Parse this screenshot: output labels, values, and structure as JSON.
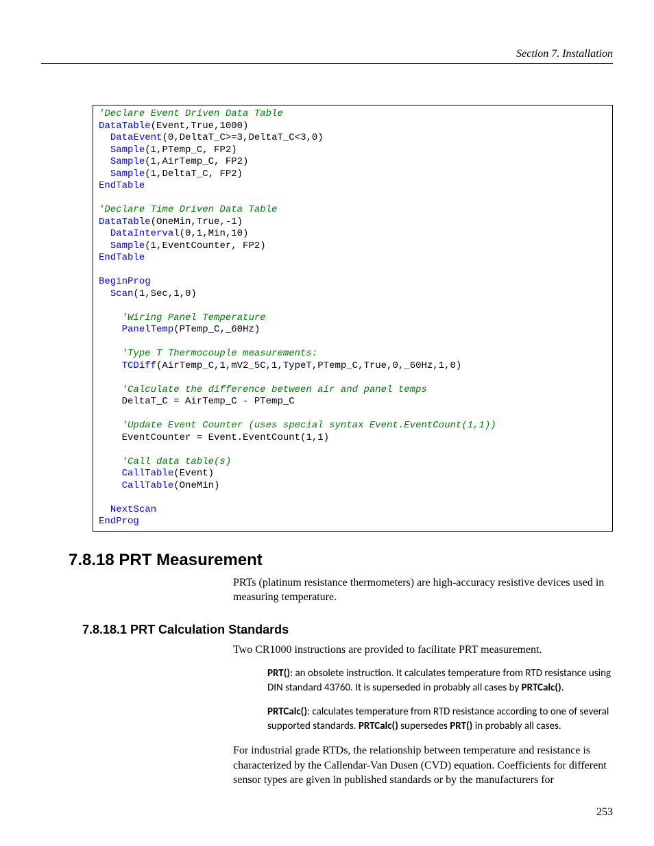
{
  "header": "Section 7.  Installation",
  "code": {
    "c1": "'Declare Event Driven Data Table",
    "l2a": "DataTable",
    "l2b": "(Event,True,1000)",
    "l3a": "DataEvent",
    "l3b": "(0,DeltaT_C>=3,DeltaT_C<3,0)",
    "l4a": "Sample",
    "l4b": "(1,PTemp_C, FP2)",
    "l5a": "Sample",
    "l5b": "(1,AirTemp_C, FP2)",
    "l6a": "Sample",
    "l6b": "(1,DeltaT_C, FP2)",
    "l7": "EndTable",
    "c2": "'Declare Time Driven Data Table",
    "l9a": "DataTable",
    "l9b": "(OneMin,True,-1)",
    "l10a": "DataInterval",
    "l10b": "(0,1,Min,10)",
    "l11a": "Sample",
    "l11b": "(1,EventCounter, FP2)",
    "l12": "EndTable",
    "l13": "BeginProg",
    "l14a": "Scan",
    "l14b": "(1,Sec,1,0)",
    "c3": "'Wiring Panel Temperature",
    "l16a": "PanelTemp",
    "l16b": "(PTemp_C,_60Hz)",
    "c4": "'Type T Thermocouple measurements:",
    "l18a": "TCDiff",
    "l18b": "(AirTemp_C,1,mV2_5C,1,TypeT,PTemp_C,True,0,_60Hz,1,0)",
    "c5": "'Calculate the difference between air and panel temps",
    "l20": "    DeltaT_C = AirTemp_C - PTemp_C",
    "c6": "'Update Event Counter (uses special syntax Event.EventCount(1,1))",
    "l22": "    EventCounter = Event.EventCount(1,1)",
    "c7": "'Call data table(s)",
    "l24a": "CallTable",
    "l24b": "(Event)",
    "l25a": "CallTable",
    "l25b": "(OneMin)",
    "l26": "NextScan",
    "l27": "EndProg"
  },
  "h2": "7.8.18 PRT Measurement",
  "p1": "PRTs (platinum resistance thermometers) are high-accuracy resistive devices used in measuring temperature.",
  "h3": "7.8.18.1 PRT Calculation Standards",
  "p2": "Two CR1000 instructions are provided to facilitate PRT measurement.",
  "b1_strong1": "PRT()",
  "b1_t1": ": an obsolete instruction.  It calculates temperature from RTD resistance using DIN standard 43760.  It is superseded in probably all cases by ",
  "b1_strong2": "PRTCalc()",
  "b1_t2": ".",
  "b2_strong1": "PRTCalc()",
  "b2_t1": ": calculates temperature from RTD resistance according to one of several supported standards.  ",
  "b2_strong2": "PRTCalc()",
  "b2_t2": " supersedes ",
  "b2_strong3": "PRT()",
  "b2_t3": " in probably all cases.",
  "p3": "For industrial grade RTDs, the relationship between temperature and resistance is characterized by the Callendar-Van Dusen (CVD) equation.  Coefficients for different sensor types are given in published standards or by the manufacturers for",
  "pagenum": "253"
}
